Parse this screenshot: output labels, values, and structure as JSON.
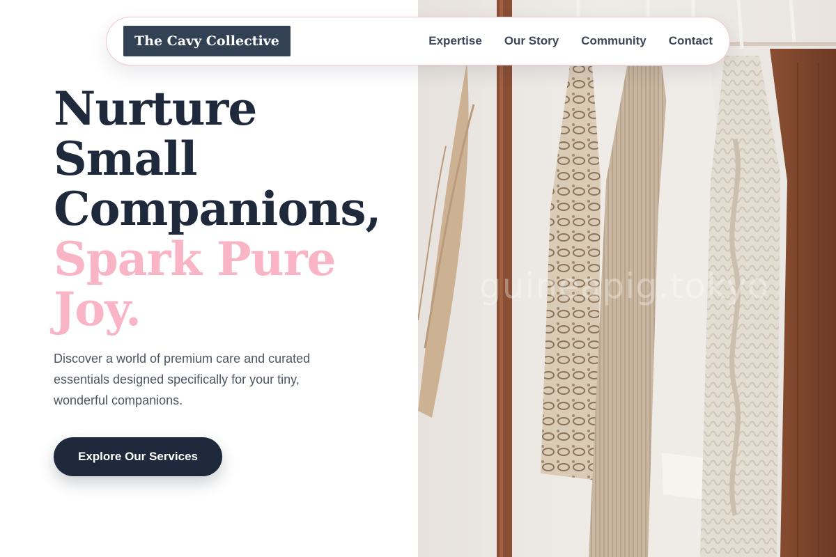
{
  "nav": {
    "brand": "The Cavy Collective",
    "links": [
      "Expertise",
      "Our Story",
      "Community",
      "Contact"
    ]
  },
  "hero": {
    "headline_dark": [
      "Nurture",
      "Small",
      "Companions,"
    ],
    "headline_accent": [
      "Spark Pure",
      "Joy."
    ],
    "description": "Discover a world of premium care and curated essentials designed specifically for your tiny, wonderful companions.",
    "cta_label": "Explore Our Services"
  },
  "image": {
    "watermark": "guineapig.tokyo",
    "subject": "clothing-rack-with-knit-sweaters"
  },
  "colors": {
    "primary": "#1e293b",
    "brand_background": "#334155",
    "accent_pink": "#f9b4c6",
    "nav_border": "#f2c7cf",
    "body_text": "#4b5563"
  }
}
